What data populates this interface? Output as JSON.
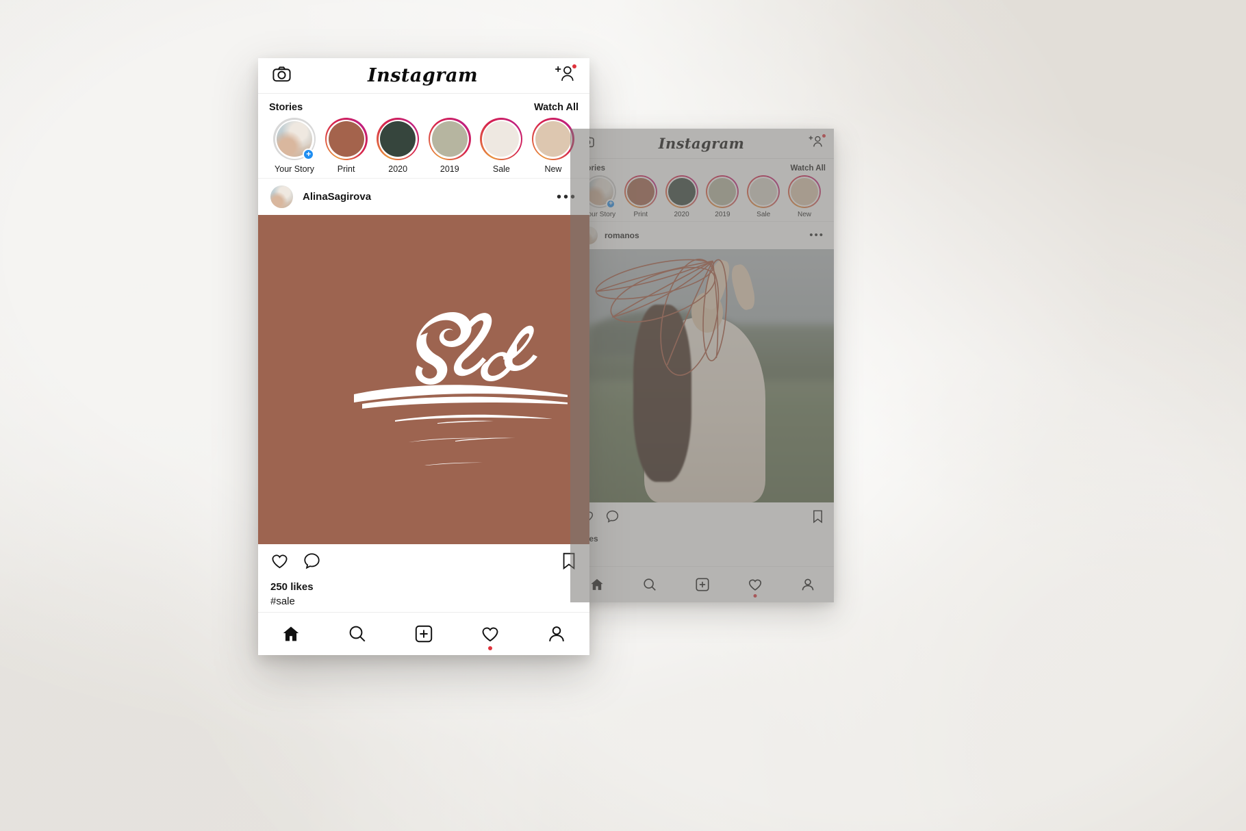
{
  "scene": {
    "background_color": "#f2f1ef",
    "description": "Instagram UI mockup, two phone screens on textured paper background"
  },
  "front_phone": {
    "topbar": {
      "camera_icon": "camera-icon",
      "logo": "Instagram",
      "add_friend_icon": "add-person-icon",
      "notification_dot_color": "#e0343d"
    },
    "stories": {
      "title": "Stories",
      "watch_all": "Watch All",
      "items": [
        {
          "label": "Your Story",
          "type": "photo",
          "has_add_badge": true,
          "badge": "+"
        },
        {
          "label": "Print",
          "type": "color",
          "color": "#a4634c"
        },
        {
          "label": "2020",
          "type": "color",
          "color": "#36453d"
        },
        {
          "label": "2019",
          "type": "color",
          "color": "#b6b5a0"
        },
        {
          "label": "Sale",
          "type": "color",
          "color": "#eee8e1"
        },
        {
          "label": "New",
          "type": "color",
          "color": "#ddc7b0"
        }
      ],
      "ring_gradient": [
        "#e8913a",
        "#d5214f",
        "#c0207e"
      ]
    },
    "post": {
      "username": "AlinaSagirova",
      "more_icon": "more-options-icon",
      "image": {
        "type": "graphic",
        "background_color": "#9d6450",
        "text": "Sale",
        "text_color": "#ffffff"
      },
      "actions": {
        "like_icon": "heart-icon",
        "comment_icon": "comment-icon",
        "save_icon": "bookmark-icon"
      },
      "likes": "250 likes",
      "caption": "#sale"
    },
    "bottom_nav": [
      {
        "name": "home",
        "icon": "home-icon",
        "active": true,
        "has_dot": false
      },
      {
        "name": "search",
        "icon": "search-icon",
        "active": false,
        "has_dot": false
      },
      {
        "name": "create",
        "icon": "plus-square-icon",
        "active": false,
        "has_dot": false
      },
      {
        "name": "activity",
        "icon": "heart-icon",
        "active": false,
        "has_dot": true
      },
      {
        "name": "profile",
        "icon": "person-icon",
        "active": false,
        "has_dot": false
      }
    ]
  },
  "back_phone": {
    "dimmed": true,
    "overlay_color": "rgba(120,118,114,0.55)",
    "topbar": {
      "camera_icon": "camera-icon",
      "logo": "Instagram",
      "add_friend_icon": "add-person-icon",
      "notification_dot_color": "#e0343d"
    },
    "stories": {
      "title": "Stories",
      "watch_all": "Watch All",
      "items": [
        {
          "label": "Your Story",
          "type": "photo",
          "has_add_badge": true,
          "badge": "+"
        },
        {
          "label": "Print",
          "type": "color",
          "color": "#a4634c"
        },
        {
          "label": "2020",
          "type": "color",
          "color": "#36453d"
        },
        {
          "label": "2019",
          "type": "color",
          "color": "#b6b5a0"
        },
        {
          "label": "Sale",
          "type": "color",
          "color": "#b2ada0"
        },
        {
          "label": "New",
          "type": "color",
          "color": "#b3a898"
        }
      ]
    },
    "post": {
      "username": "romanos",
      "more_icon": "more-options-icon",
      "image": {
        "type": "photo",
        "description": "woman in white knit sweater in field with line-art floral overlay"
      },
      "actions": {
        "like_icon": "heart-icon",
        "comment_icon": "comment-icon",
        "save_icon": "bookmark-icon"
      },
      "likes": "likes"
    },
    "bottom_nav": [
      {
        "name": "home",
        "icon": "home-icon",
        "active": true,
        "has_dot": false
      },
      {
        "name": "search",
        "icon": "search-icon",
        "active": false,
        "has_dot": false
      },
      {
        "name": "create",
        "icon": "plus-square-icon",
        "active": false,
        "has_dot": false
      },
      {
        "name": "activity",
        "icon": "heart-icon",
        "active": false,
        "has_dot": true
      },
      {
        "name": "profile",
        "icon": "person-icon",
        "active": false,
        "has_dot": false
      }
    ]
  }
}
